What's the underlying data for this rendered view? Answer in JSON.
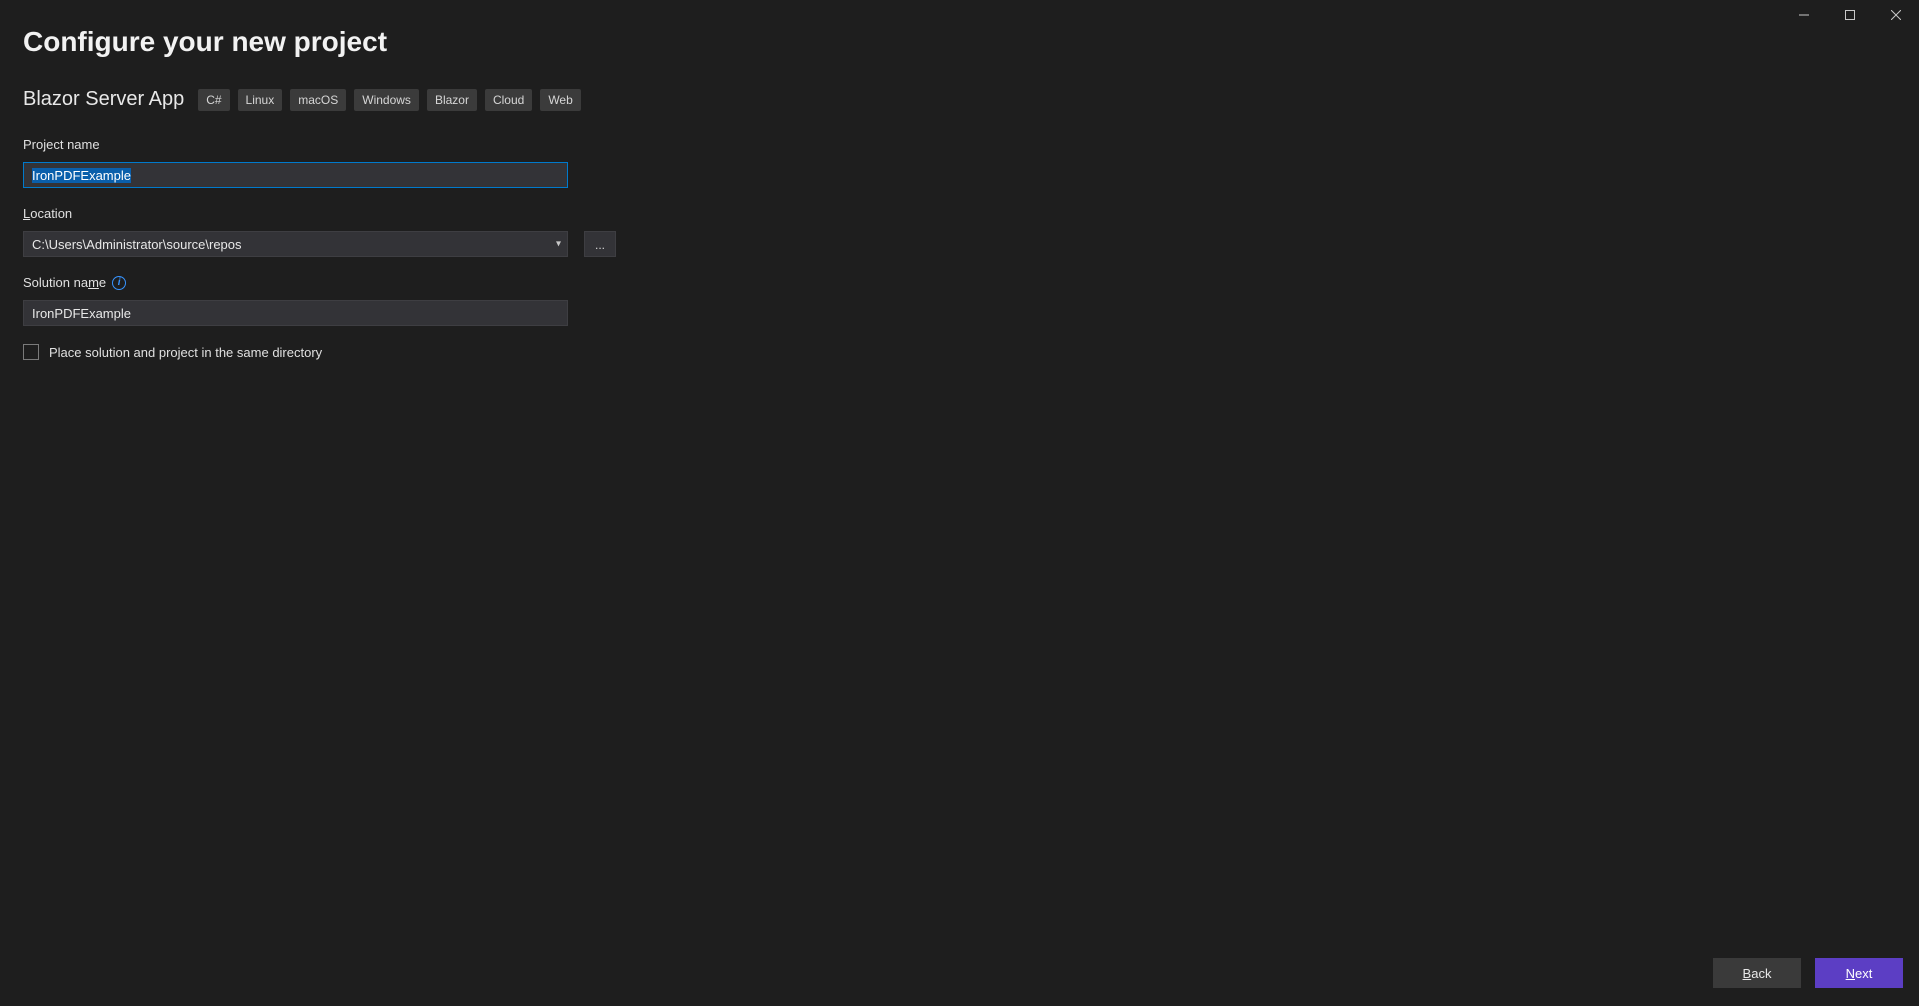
{
  "window": {
    "minimize_title": "Minimize",
    "maximize_title": "Maximize",
    "close_title": "Close"
  },
  "header": {
    "title": "Configure your new project",
    "template_name": "Blazor Server App",
    "tags": [
      "C#",
      "Linux",
      "macOS",
      "Windows",
      "Blazor",
      "Cloud",
      "Web"
    ]
  },
  "fields": {
    "project_name_label": "Project name",
    "project_name_value": "IronPDFExample",
    "location_label_pre": "L",
    "location_label_post": "ocation",
    "location_value": "C:\\Users\\Administrator\\source\\repos",
    "browse_label": "...",
    "solution_name_label_pre": "Solution na",
    "solution_name_label_u": "m",
    "solution_name_label_post": "e",
    "solution_name_value": "IronPDFExample",
    "same_dir_pre": "Place solution and project in the same ",
    "same_dir_u": "d",
    "same_dir_post": "irectory",
    "same_dir_checked": false,
    "info_tooltip": "i"
  },
  "footer": {
    "back_u": "B",
    "back_post": "ack",
    "next_u": "N",
    "next_post": "ext"
  },
  "colors": {
    "bg": "#1e1e1e",
    "accent": "#007acc",
    "selection": "#0a5fab",
    "primary_btn": "#5c3ec4",
    "info": "#3794ff"
  }
}
